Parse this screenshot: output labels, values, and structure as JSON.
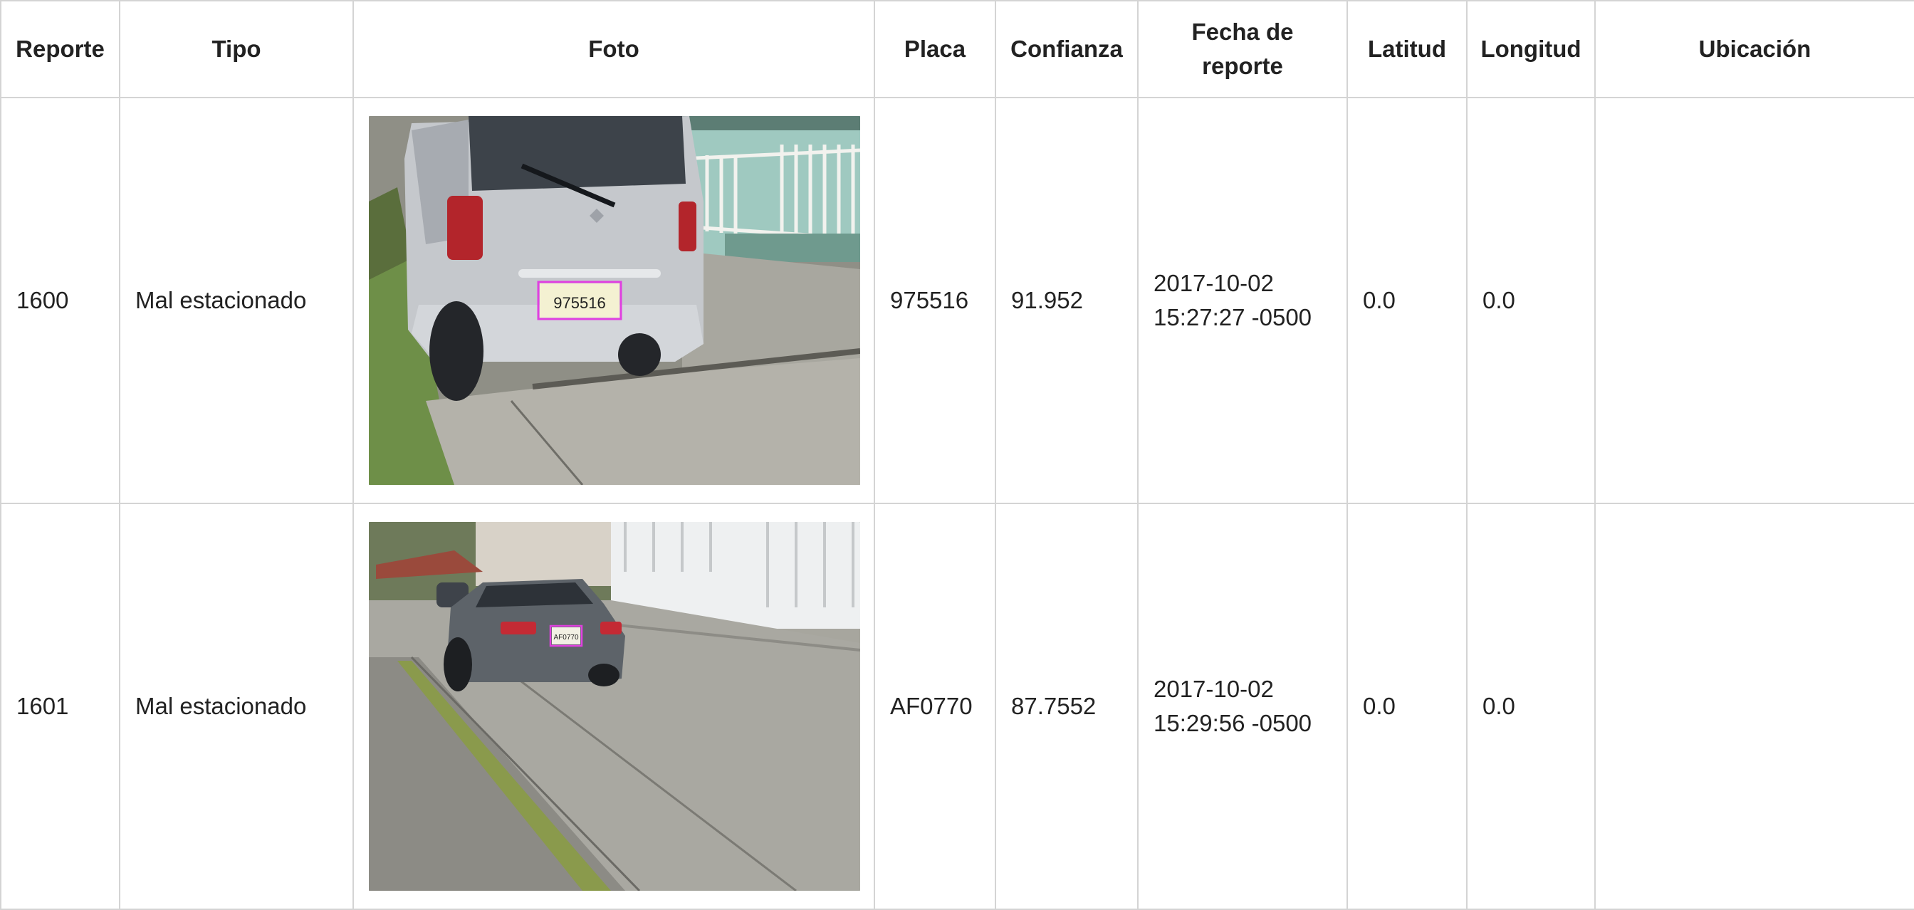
{
  "table": {
    "headers": {
      "reporte": "Reporte",
      "tipo": "Tipo",
      "foto": "Foto",
      "placa": "Placa",
      "confianza": "Confianza",
      "fecha_line1": "Fecha de",
      "fecha_line2": "reporte",
      "latitud": "Latitud",
      "longitud": "Longitud",
      "ubicacion": "Ubicación"
    },
    "rows": [
      {
        "reporte": "1600",
        "tipo": "Mal estacionado",
        "foto_plate_text": "975516",
        "placa": "975516",
        "confianza": "91.952",
        "fecha_line1": "2017-10-02",
        "fecha_line2": "15:27:27 -0500",
        "latitud": "0.0",
        "longitud": "0.0",
        "ubicacion": ""
      },
      {
        "reporte": "1601",
        "tipo": "Mal estacionado",
        "foto_plate_text": "AF0770",
        "placa": "AF0770",
        "confianza": "87.7552",
        "fecha_line1": "2017-10-02",
        "fecha_line2": "15:29:56 -0500",
        "latitud": "0.0",
        "longitud": "0.0",
        "ubicacion": ""
      }
    ]
  },
  "colors": {
    "border": "#d4d4d4",
    "text": "#222222",
    "plate_highlight": "#e040e0"
  }
}
